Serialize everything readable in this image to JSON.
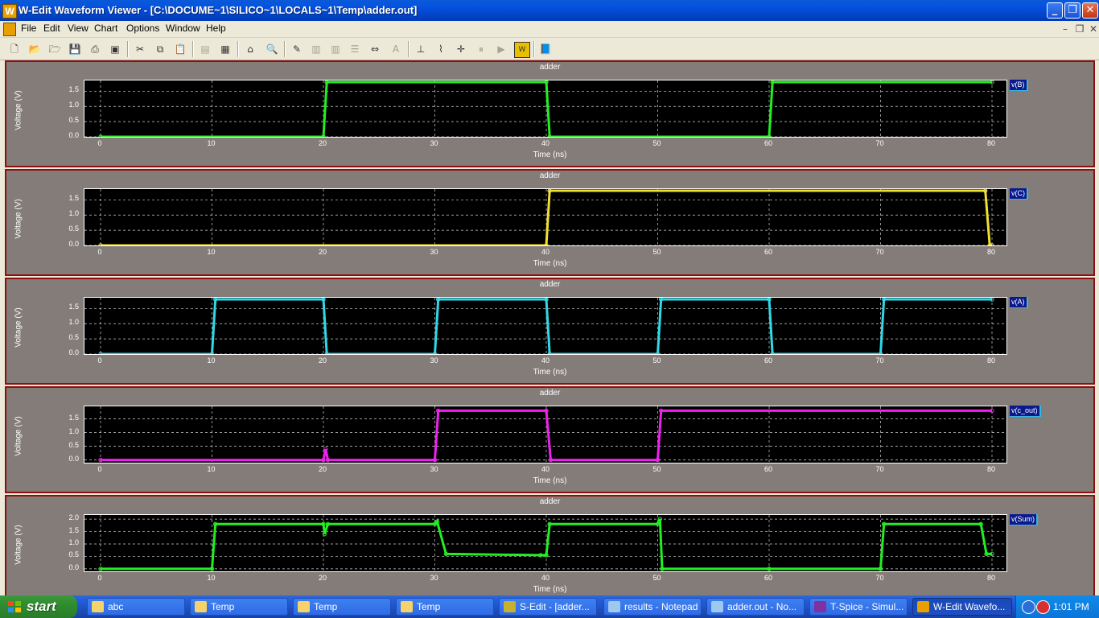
{
  "window": {
    "title": "W-Edit Waveform Viewer - [C:\\DOCUME~1\\SILICO~1\\LOCALS~1\\Temp\\adder.out]",
    "app_icon_letter": "W"
  },
  "menu": [
    "File",
    "Edit",
    "View",
    "Chart",
    "Options",
    "Window",
    "Help"
  ],
  "toolbar_icons": [
    "new-icon",
    "open-icon",
    "open-multiple-icon",
    "save-icon",
    "print-icon",
    "screenshot-icon",
    "cut-icon",
    "copy-icon",
    "paste-icon",
    "group-icon",
    "ungroup-icon",
    "home-icon",
    "zoom-icon",
    "edit-chart-icon",
    "arrange-icon",
    "align-icon",
    "distribute-icon",
    "fit-icon",
    "text-icon",
    "measure-icon",
    "cursor-icon",
    "marker-icon",
    "pause-icon",
    "play-icon",
    "wedit-icon",
    "help-book-icon"
  ],
  "panels": [
    {
      "title": "adder",
      "ylabel": "Voltage (V)",
      "xlabel": "Time (ns)",
      "legend": "v(B)",
      "color": "#22ee22",
      "yticks": [
        "1.5",
        "1.0",
        "0.5",
        "0.0"
      ],
      "ytick_values": [
        1.5,
        1.0,
        0.5,
        0.0
      ],
      "ymin": 0.0,
      "ymax": 1.8,
      "xticks": [
        "0",
        "10",
        "20",
        "30",
        "40",
        "50",
        "60",
        "70",
        "80"
      ],
      "chart_data": {
        "type": "line",
        "series": [
          {
            "name": "v(B)",
            "x": [
              0,
              20,
              20.3,
              40,
              40.3,
              60,
              60.3,
              80
            ],
            "y": [
              0,
              0,
              1.8,
              1.8,
              0,
              0,
              1.8,
              1.8
            ]
          }
        ],
        "xlim": [
          0,
          80
        ],
        "ylim": [
          0,
          1.8
        ]
      }
    },
    {
      "title": "adder",
      "ylabel": "Voltage (V)",
      "xlabel": "Time (ns)",
      "legend": "v(C)",
      "color": "#f0e030",
      "yticks": [
        "1.5",
        "1.0",
        "0.5",
        "0.0"
      ],
      "ytick_values": [
        1.5,
        1.0,
        0.5,
        0.0
      ],
      "ymin": 0.0,
      "ymax": 1.8,
      "xticks": [
        "0",
        "10",
        "20",
        "30",
        "40",
        "50",
        "60",
        "70",
        "80"
      ],
      "chart_data": {
        "type": "line",
        "series": [
          {
            "name": "v(C)",
            "x": [
              0,
              40,
              40.3,
              79.4,
              79.8,
              80
            ],
            "y": [
              0,
              0,
              1.8,
              1.8,
              0,
              0
            ]
          }
        ],
        "xlim": [
          0,
          80
        ],
        "ylim": [
          0,
          1.8
        ]
      }
    },
    {
      "title": "adder",
      "ylabel": "Voltage (V)",
      "xlabel": "Time (ns)",
      "legend": "v(A)",
      "color": "#30d8e8",
      "yticks": [
        "1.5",
        "1.0",
        "0.5",
        "0.0"
      ],
      "ytick_values": [
        1.5,
        1.0,
        0.5,
        0.0
      ],
      "ymin": 0.0,
      "ymax": 1.8,
      "xticks": [
        "0",
        "10",
        "20",
        "30",
        "40",
        "50",
        "60",
        "70",
        "80"
      ],
      "chart_data": {
        "type": "line",
        "series": [
          {
            "name": "v(A)",
            "x": [
              0,
              10,
              10.3,
              20,
              20.3,
              30,
              30.3,
              40,
              40.3,
              50,
              50.3,
              60,
              60.3,
              70,
              70.3,
              80
            ],
            "y": [
              0,
              0,
              1.8,
              1.8,
              0,
              0,
              1.8,
              1.8,
              0,
              0,
              1.8,
              1.8,
              0,
              0,
              1.8,
              1.8
            ]
          }
        ],
        "xlim": [
          0,
          80
        ],
        "ylim": [
          0,
          1.8
        ]
      }
    },
    {
      "title": "adder",
      "ylabel": "Voltage (V)",
      "xlabel": "Time (ns)",
      "legend": "v(c_out)",
      "color": "#ee22ee",
      "yticks": [
        "1.5",
        "1.0",
        "0.5",
        "0.0"
      ],
      "ytick_values": [
        1.5,
        1.0,
        0.5,
        0.0
      ],
      "ymin": -0.1,
      "ymax": 1.9,
      "xticks": [
        "0",
        "10",
        "20",
        "30",
        "40",
        "50",
        "60",
        "70",
        "80"
      ],
      "chart_data": {
        "type": "line",
        "series": [
          {
            "name": "v(c_out)",
            "x": [
              0,
              20,
              20.2,
              20.4,
              30,
              30.3,
              40,
              40.4,
              50,
              50.3,
              80
            ],
            "y": [
              0,
              0,
              0.4,
              0,
              0,
              1.8,
              1.8,
              0,
              0,
              1.8,
              1.8
            ]
          }
        ],
        "xlim": [
          0,
          80
        ],
        "ylim": [
          -0.1,
          1.9
        ]
      }
    },
    {
      "title": "adder",
      "ylabel": "Voltage (V)",
      "xlabel": "Time (ns)",
      "legend": "v(Sum)",
      "color": "#22ee22",
      "yticks": [
        "2.0",
        "1.5",
        "1.0",
        "0.5",
        "0.0"
      ],
      "ytick_values": [
        2.0,
        1.5,
        1.0,
        0.5,
        0.0
      ],
      "ymin": -0.1,
      "ymax": 2.1,
      "xticks": [
        "0",
        "10",
        "20",
        "30",
        "40",
        "50",
        "60",
        "70",
        "80"
      ],
      "chart_data": {
        "type": "line",
        "series": [
          {
            "name": "v(Sum)",
            "x": [
              0,
              10,
              10.3,
              20,
              20.1,
              20.4,
              30,
              30.2,
              31,
              39.5,
              40,
              40.3,
              50,
              50.2,
              50.4,
              60,
              70,
              70.3,
              79,
              79.5,
              80
            ],
            "y": [
              0,
              0,
              1.8,
              1.8,
              1.4,
              1.8,
              1.8,
              1.9,
              0.6,
              0.55,
              0.55,
              1.8,
              1.8,
              2.0,
              0,
              0,
              0,
              1.8,
              1.8,
              0.6,
              0.6
            ]
          }
        ],
        "xlim": [
          0,
          80
        ],
        "ylim": [
          -0.1,
          2.1
        ]
      }
    }
  ],
  "taskbar": {
    "start_label": "start",
    "tasks": [
      {
        "label": "abc",
        "icon": "folder-icon",
        "color": "#f5d36a"
      },
      {
        "label": "Temp",
        "icon": "folder-icon",
        "color": "#f5d36a"
      },
      {
        "label": "Temp",
        "icon": "folder-icon",
        "color": "#f5d36a"
      },
      {
        "label": "Temp",
        "icon": "folder-icon",
        "color": "#f5d36a"
      },
      {
        "label": "S-Edit - [adder...",
        "icon": "sedit-icon",
        "color": "#c8b030"
      },
      {
        "label": "results - Notepad",
        "icon": "notepad-icon",
        "color": "#9ec8f0"
      },
      {
        "label": "adder.out - No...",
        "icon": "notepad-icon",
        "color": "#9ec8f0"
      },
      {
        "label": "T-Spice - Simul...",
        "icon": "tspice-icon",
        "color": "#8030a0"
      },
      {
        "label": "W-Edit Wavefo...",
        "icon": "wedit-icon",
        "color": "#e8a000"
      }
    ],
    "clock": "1:01 PM"
  }
}
